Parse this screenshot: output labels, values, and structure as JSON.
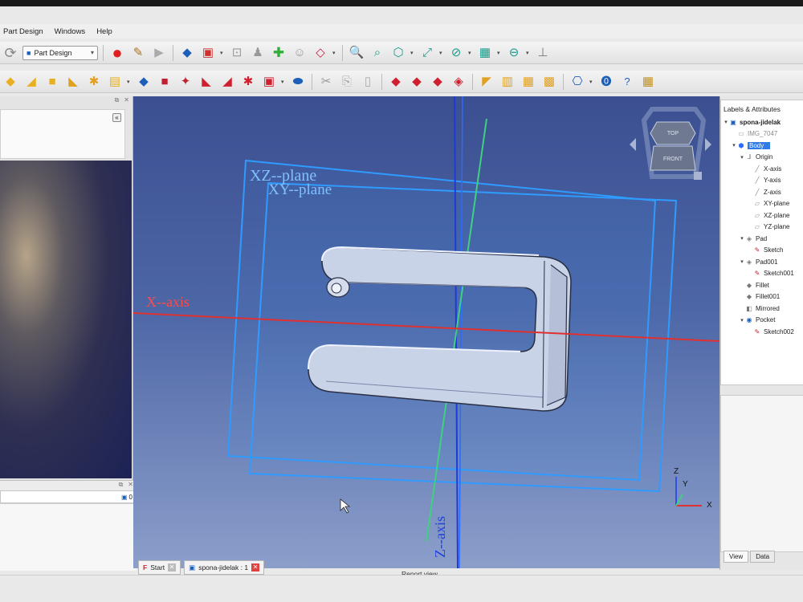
{
  "menu": [
    "Part Design",
    "Windows",
    "Help"
  ],
  "workbench": {
    "label": "Part Design"
  },
  "toolbar1": {
    "icons": [
      "refresh-icon",
      "part-design-workbench-icon",
      "record-macro-icon",
      "macro-editor-icon",
      "play-macro-icon",
      "box-icon",
      "part-icon",
      "lock-icon",
      "person-icon",
      "puzzle-icon",
      "face-icon",
      "diamond-icon",
      "zoom-fit-icon",
      "zoom-selection-icon",
      "isometric-icon",
      "measure-icon",
      "no-sign-icon",
      "cube-view-icon",
      "zoom-out-icon",
      "caliper-icon"
    ],
    "colors": {
      "red": "#e02020",
      "blue": "#1b5fb8",
      "green": "#2fae3a",
      "teal": "#1a9a8a"
    }
  },
  "toolbar2": {
    "icons": [
      "pad-yellow-icon",
      "revolution-icon",
      "additive-box-icon",
      "additive-cyl-icon",
      "sweep-icon",
      "loft-icon",
      "pocket-icon",
      "hole-icon",
      "groove-icon",
      "subtractive-icon",
      "subtractive-loft-icon",
      "subtractive-helix-icon",
      "boolean-icon",
      "cut-icon",
      "copy-icon",
      "paste-icon",
      "fillet-icon",
      "chamfer-icon",
      "draft-icon",
      "thickness-icon",
      "mirror-icon",
      "linear-pattern-icon",
      "polar-pattern-icon",
      "multitransform-icon",
      "whatsthis-icon",
      "help-icon",
      "help2-icon",
      "grid-icon"
    ]
  },
  "viewport": {
    "planes": [
      "XZ--plane",
      "XY--plane"
    ],
    "axes": [
      "X--axis",
      "Z--axis"
    ],
    "navcube": {
      "top": "TOP",
      "front": "FRONT"
    },
    "triad": {
      "z": "Z",
      "y": "Y",
      "x": "X"
    },
    "colors": {
      "x_axis": "#e03030",
      "z_axis": "#1f3bd6",
      "y_axis": "#40d080",
      "plane": "#2f9bff"
    }
  },
  "tree": {
    "title": "Labels & Attributes",
    "rows": [
      {
        "label": "spona-jidelak",
        "icon": "document-icon",
        "arrow": "▾",
        "indent": 0,
        "selected": false,
        "gray": false,
        "bold": true
      },
      {
        "label": "IMG_7047",
        "icon": "image-icon",
        "arrow": "",
        "indent": 1,
        "selected": false,
        "gray": true,
        "bold": false
      },
      {
        "label": "Body",
        "icon": "body-icon",
        "arrow": "▾",
        "indent": 1,
        "selected": true,
        "gray": false,
        "bold": false
      },
      {
        "label": "Origin",
        "icon": "origin-icon",
        "arrow": "▾",
        "indent": 2,
        "selected": false,
        "gray": false,
        "bold": false
      },
      {
        "label": "X-axis",
        "icon": "axis-icon",
        "arrow": "",
        "indent": 3,
        "selected": false,
        "gray": false,
        "bold": false
      },
      {
        "label": "Y-axis",
        "icon": "axis-icon",
        "arrow": "",
        "indent": 3,
        "selected": false,
        "gray": false,
        "bold": false
      },
      {
        "label": "Z-axis",
        "icon": "axis-icon",
        "arrow": "",
        "indent": 3,
        "selected": false,
        "gray": false,
        "bold": false
      },
      {
        "label": "XY-plane",
        "icon": "plane-icon",
        "arrow": "",
        "indent": 3,
        "selected": false,
        "gray": false,
        "bold": false
      },
      {
        "label": "XZ-plane",
        "icon": "plane-icon",
        "arrow": "",
        "indent": 3,
        "selected": false,
        "gray": false,
        "bold": false
      },
      {
        "label": "YZ-plane",
        "icon": "plane-icon",
        "arrow": "",
        "indent": 3,
        "selected": false,
        "gray": false,
        "bold": false
      },
      {
        "label": "Pad",
        "icon": "pad-icon",
        "arrow": "▾",
        "indent": 2,
        "selected": false,
        "gray": false,
        "bold": false
      },
      {
        "label": "Sketch",
        "icon": "sketch-icon",
        "arrow": "",
        "indent": 3,
        "selected": false,
        "gray": false,
        "bold": false
      },
      {
        "label": "Pad001",
        "icon": "pad-icon",
        "arrow": "▾",
        "indent": 2,
        "selected": false,
        "gray": false,
        "bold": false
      },
      {
        "label": "Sketch001",
        "icon": "sketch-icon",
        "arrow": "",
        "indent": 3,
        "selected": false,
        "gray": false,
        "bold": false
      },
      {
        "label": "Fillet",
        "icon": "fillet-icon",
        "arrow": "",
        "indent": 2,
        "selected": false,
        "gray": false,
        "bold": false
      },
      {
        "label": "Fillet001",
        "icon": "fillet-icon",
        "arrow": "",
        "indent": 2,
        "selected": false,
        "gray": false,
        "bold": false
      },
      {
        "label": "Mirrored",
        "icon": "mirrored-icon",
        "arrow": "",
        "indent": 2,
        "selected": false,
        "gray": false,
        "bold": false
      },
      {
        "label": "Pocket",
        "icon": "pocket-icon",
        "arrow": "▾",
        "indent": 2,
        "selected": false,
        "gray": false,
        "bold": false
      },
      {
        "label": "Sketch002",
        "icon": "sketch-icon",
        "arrow": "",
        "indent": 3,
        "selected": false,
        "gray": false,
        "bold": false
      }
    ]
  },
  "view_tabs": [
    "View",
    "Data"
  ],
  "doc_tabs": [
    {
      "label": "Start",
      "icon": "freecad-icon"
    },
    {
      "label": "spona-jidelak : 1",
      "icon": "document-icon"
    }
  ],
  "report_view": "Report view",
  "left_bottom": {
    "value": "0"
  }
}
